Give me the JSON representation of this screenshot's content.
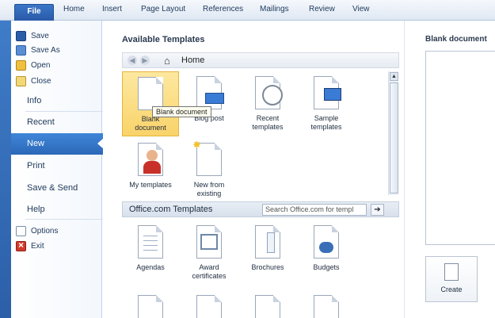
{
  "ribbon": {
    "tabs": [
      "File",
      "Home",
      "Insert",
      "Page Layout",
      "References",
      "Mailings",
      "Review",
      "View"
    ]
  },
  "backstage": {
    "commands": [
      {
        "label": "Save",
        "icon": "save-icon"
      },
      {
        "label": "Save As",
        "icon": "save-as-icon"
      },
      {
        "label": "Open",
        "icon": "open-folder-icon"
      },
      {
        "label": "Close",
        "icon": "close-folder-icon"
      }
    ],
    "nav": [
      "Info",
      "Recent",
      "New",
      "Print",
      "Save & Send",
      "Help"
    ],
    "selected": "New",
    "bottom": [
      {
        "label": "Options",
        "icon": "options-icon"
      },
      {
        "label": "Exit",
        "icon": "exit-icon"
      }
    ]
  },
  "center": {
    "title": "Available Templates",
    "breadcrumb": "Home",
    "tooltip": "Blank document",
    "templates": [
      {
        "line1": "Blank",
        "line2": "document"
      },
      {
        "line1": "Blog post",
        "line2": ""
      },
      {
        "line1": "Recent",
        "line2": "templates"
      },
      {
        "line1": "Sample",
        "line2": "templates"
      },
      {
        "line1": "My templates",
        "line2": ""
      },
      {
        "line1": "New from",
        "line2": "existing"
      }
    ],
    "office_title": "Office.com Templates",
    "search_placeholder": "Search Office.com for templ",
    "office_templates": [
      {
        "line1": "Agendas",
        "line2": ""
      },
      {
        "line1": "Award",
        "line2": "certificates"
      },
      {
        "line1": "Brochures",
        "line2": ""
      },
      {
        "line1": "Budgets",
        "line2": ""
      }
    ]
  },
  "right": {
    "title": "Blank document",
    "create": "Create"
  }
}
